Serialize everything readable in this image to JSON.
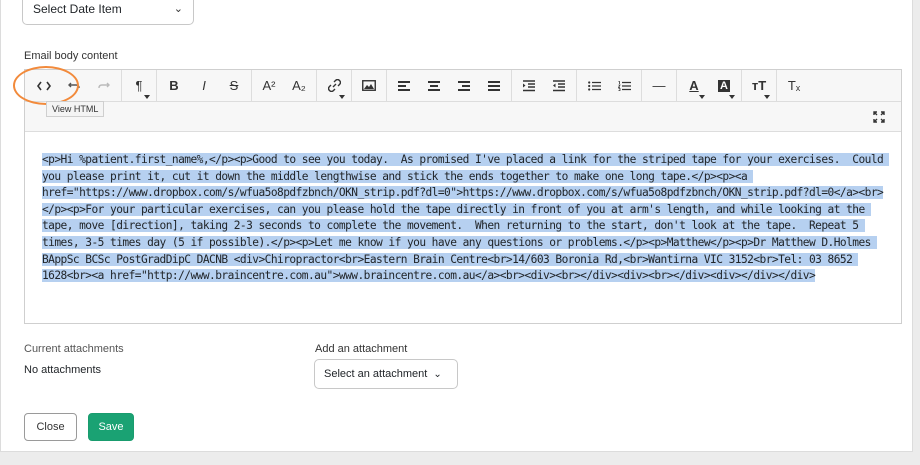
{
  "top_select": {
    "value": "Select Date Item"
  },
  "email_body": {
    "label": "Email body content"
  },
  "toolbar": {
    "view_html": {
      "icon": "code-icon",
      "tooltip": "View HTML"
    },
    "undo_icon": "undo-icon",
    "redo_icon": "redo-icon",
    "paragraph": "¶",
    "bold": "B",
    "italic": "I",
    "strike": "S",
    "superscript": "A²",
    "subscript": "A₂",
    "link_icon": "link-icon",
    "image_icon": "image-icon",
    "hr": "—",
    "font_color": "A",
    "bg_color": "A",
    "font_size": "тТ",
    "clear_format": "Tₓ",
    "fullscreen_icon": "fullscreen-icon"
  },
  "editor_content": "<p>Hi %patient.first_name%,</p><p>Good to see you today.  As promised I've placed a link for the striped tape for your exercises.  Could you please print it, cut it down the middle lengthwise and stick the ends together to make one long tape.</p><p><a href=\"https://www.dropbox.com/s/wfua5o8pdfzbnch/OKN_strip.pdf?dl=0\">https://www.dropbox.com/s/wfua5o8pdfzbnch/OKN_strip.pdf?dl=0</a><br></p><p>For your particular exercises, can you please hold the tape directly in front of you at arm's length, and while looking at the tape, move [direction], taking 2-3 seconds to complete the movement.  When returning to the start, don't look at the tape.  Repeat 5 times, 3-5 times day (5 if possible).</p><p>Let me know if you have any questions or problems.</p><p>Matthew</p><p>Dr Matthew D.Holmes BAppSc BCSc PostGradDipC DACNB <div>Chiropractor<br>Eastern Brain Centre<br>14/603 Boronia Rd,<br>Wantirna VIC 3152<br>Tel: 03 8652 1628<br><a href=\"http://www.braincentre.com.au\">www.braincentre.com.au</a><br><div><br></div><div><br></div><div></div></div>",
  "attachments": {
    "current_label": "Current attachments",
    "current_value": "No attachments",
    "add_label": "Add an attachment",
    "add_select": "Select an attachment"
  },
  "buttons": {
    "close": "Close",
    "save": "Save"
  },
  "colors": {
    "annotation": "#f28a3b",
    "selection": "#b6d0f0",
    "save": "#1aa273"
  }
}
